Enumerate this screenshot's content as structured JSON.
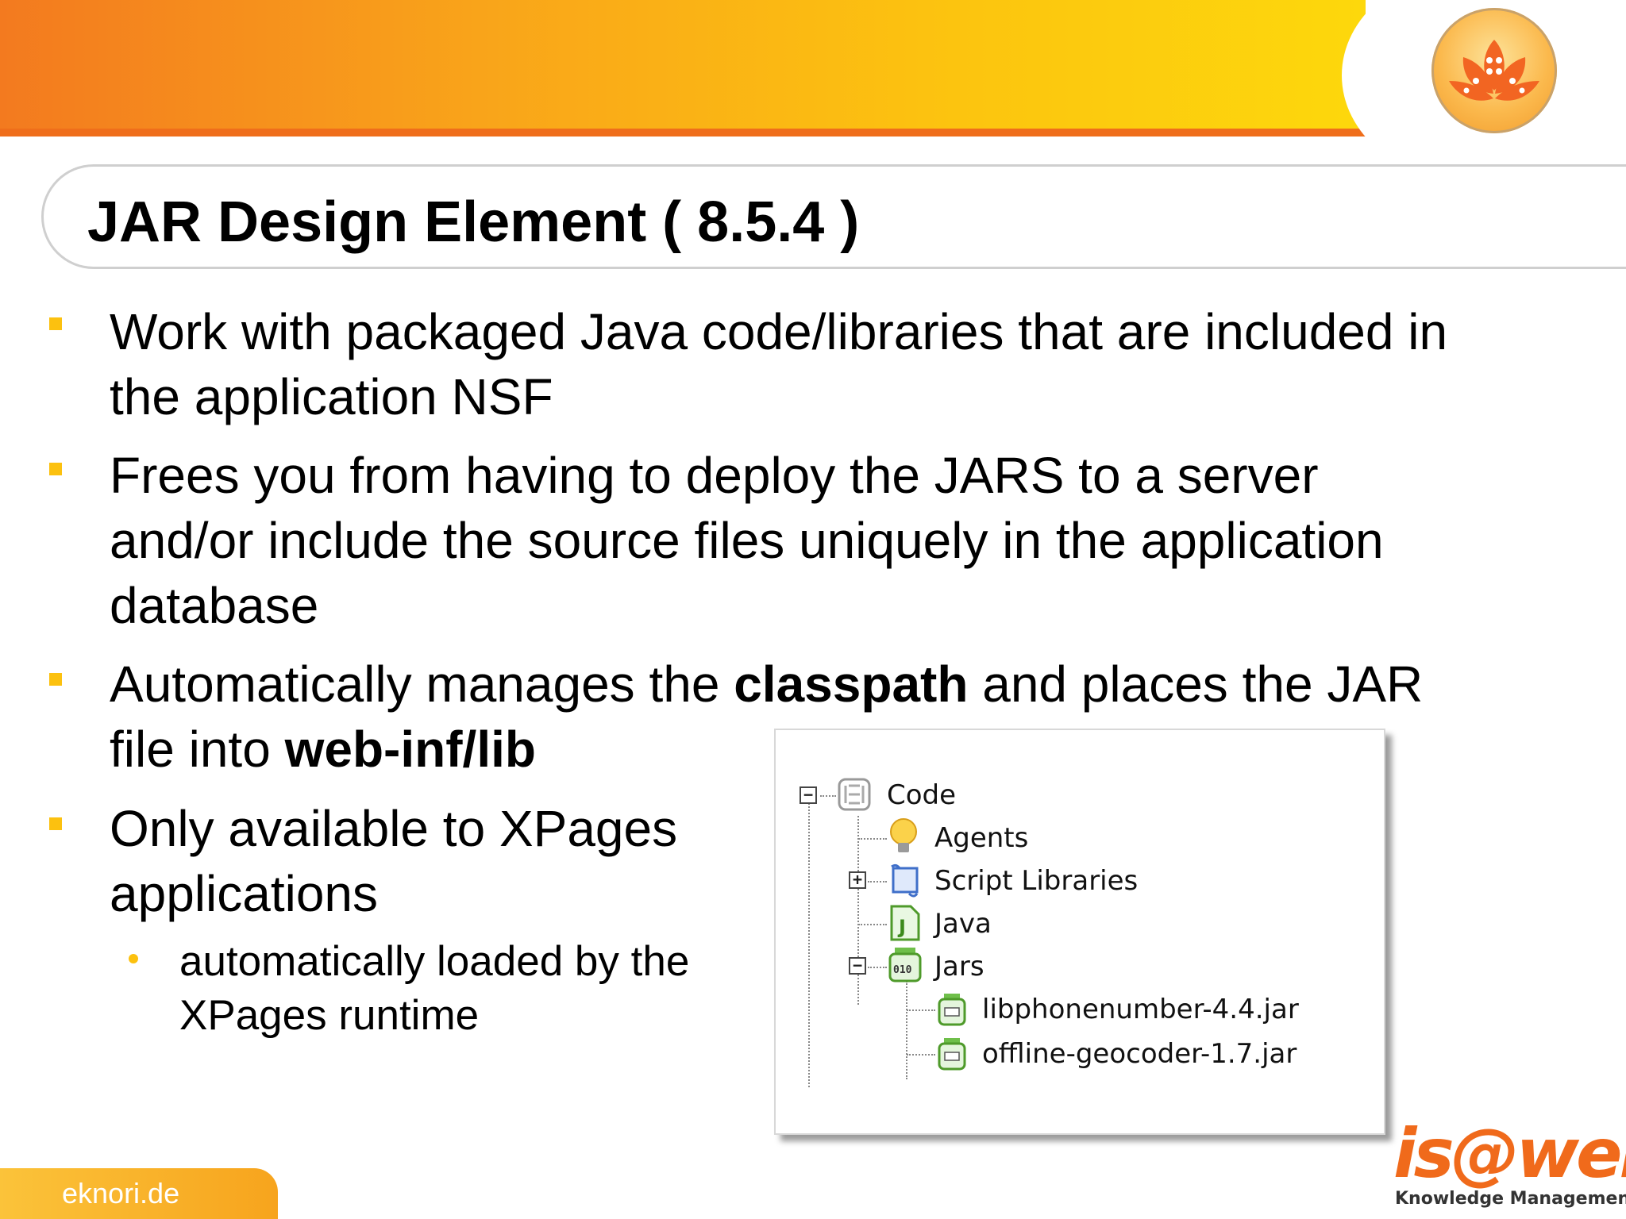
{
  "slide": {
    "title": "JAR Design Element ( 8.5.4 )",
    "bullets": [
      {
        "lines": [
          [
            "Work with packaged Java code/libraries that are included in"
          ],
          [
            "the application NSF"
          ]
        ]
      },
      {
        "lines": [
          [
            "Frees you from having to deploy the JARS to a server"
          ],
          [
            "and/or include the source files uniquely in the application"
          ],
          [
            "database"
          ]
        ]
      },
      {
        "line1_pre": "Automatically manages the ",
        "line1_bold": "classpath",
        "line1_post": " and places the JAR",
        "line2_pre": "file into ",
        "line2_bold": "web-inf/lib"
      },
      {
        "line1": "Only available to XPages",
        "line2": "applications"
      }
    ],
    "sub_bullet": {
      "line1": "automatically loaded by the",
      "line2": "XPages runtime"
    }
  },
  "tree": {
    "code": "Code",
    "agents": "Agents",
    "script_libraries": "Script Libraries",
    "java": "Java",
    "jars": "Jars",
    "jar1": "libphonenumber-4.4.jar",
    "jar2": "offline-geocoder-1.7.jar",
    "java_icon_letter": "J",
    "jars_icon_text": "010",
    "expanded_symbol": "−",
    "collapsed_symbol": "+"
  },
  "footer": {
    "site": "eknori.de",
    "brand_word": "is@web",
    "brand_sub": "Knowledge Management"
  },
  "colors": {
    "accent_orange": "#f37a1f",
    "accent_yellow": "#fcc10f",
    "brand_orange": "#f06a1b"
  }
}
